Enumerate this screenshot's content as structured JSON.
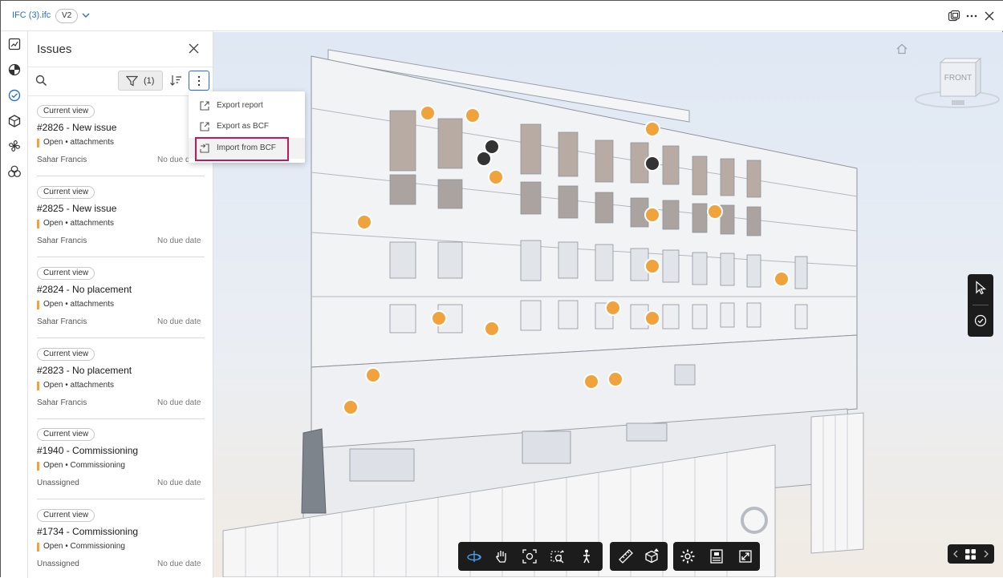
{
  "header": {
    "file_name": "IFC (3).ifc",
    "version": "V2",
    "icons": [
      "chevron-down-icon",
      "compare-icon",
      "more-icon",
      "close-icon"
    ]
  },
  "rail": {
    "icons": [
      "sheets-icon",
      "models-icon",
      "issues-icon",
      "objects-icon",
      "pinwheel-icon",
      "collab-icon"
    ],
    "active": "issues-icon"
  },
  "issues_panel": {
    "title": "Issues",
    "filter_count": "(1)",
    "menu": {
      "items": [
        {
          "label": "Export report"
        },
        {
          "label": "Export as BCF"
        },
        {
          "label": "Import from BCF"
        }
      ]
    },
    "issues": [
      {
        "chip": "Current view",
        "title": "#2826 - New issue",
        "status": "Open • attachments",
        "assignee": "Sahar Francis",
        "due": "No due date"
      },
      {
        "chip": "Current view",
        "title": "#2825 - New issue",
        "status": "Open • attachments",
        "assignee": "Sahar Francis",
        "due": "No due date"
      },
      {
        "chip": "Current view",
        "title": "#2824 - No placement",
        "status": "Open • attachments",
        "assignee": "Sahar Francis",
        "due": "No due date"
      },
      {
        "chip": "Current view",
        "title": "#2823 - No placement",
        "status": "Open • attachments",
        "assignee": "Sahar Francis",
        "due": "No due date"
      },
      {
        "chip": "Current view",
        "title": "#1940 - Commissioning",
        "status": "Open • Commissioning",
        "assignee": "Unassigned",
        "due": "No due date"
      },
      {
        "chip": "Current view",
        "title": "#1734 - Commissioning",
        "status": "Open • Commissioning",
        "assignee": "Unassigned",
        "due": "No due date"
      }
    ]
  },
  "viewer": {
    "viewcube_label": "FRONT",
    "colors": {
      "issue_pin": "#f0a33c",
      "selected_pin": "#333333",
      "toolbar": "#1c1c1c",
      "highlight": "#c2185b",
      "accent": "#2a6fd6"
    }
  }
}
